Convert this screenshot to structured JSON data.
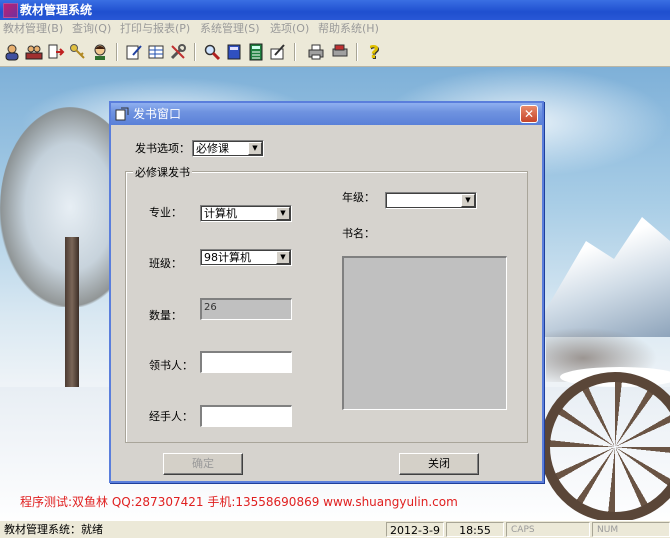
{
  "app": {
    "title": "教材管理系统"
  },
  "menu": [
    "教材管理(B)",
    "查询(Q)",
    "打印与报表(P)",
    "系统管理(S)",
    "选项(O)",
    "帮助系统(H)"
  ],
  "toolbar": {
    "icons": [
      "user-icon",
      "users-icon",
      "import-icon",
      "key-icon",
      "person-icon",
      "edit-icon",
      "table-icon",
      "tools-icon",
      "search-icon",
      "book-icon",
      "calculator-icon",
      "write-icon",
      "printer-icon",
      "print-preview-icon",
      "help-icon"
    ]
  },
  "dialog": {
    "title": "发书窗口",
    "close_glyph": "✕",
    "option_label": "发书选项：",
    "option_value": "必修课",
    "group_title": "必修课发书",
    "major_label": "专业：",
    "major_value": "计算机",
    "class_label": "班级：",
    "class_value": "98计算机",
    "quantity_label": "数量：",
    "quantity_value": "26",
    "receiver_label": "领书人：",
    "receiver_value": "",
    "handler_label": "经手人：",
    "handler_value": "",
    "grade_label": "年级：",
    "grade_value": "",
    "bookname_label": "书名：",
    "confirm_label": "确定",
    "close_label": "关闭"
  },
  "watermark": "程序测试:双鱼林 QQ:287307421 手机:13558690869 www.shuangyulin.com",
  "status": {
    "message": "教材管理系统：就绪",
    "date": "2012-3-9",
    "time": "18:55",
    "caps": "CAPS",
    "num": "NUM"
  },
  "colors": {
    "title_bar": "#2957d6",
    "dialog_title": "#6f93e0",
    "watermark": "#e02020"
  }
}
